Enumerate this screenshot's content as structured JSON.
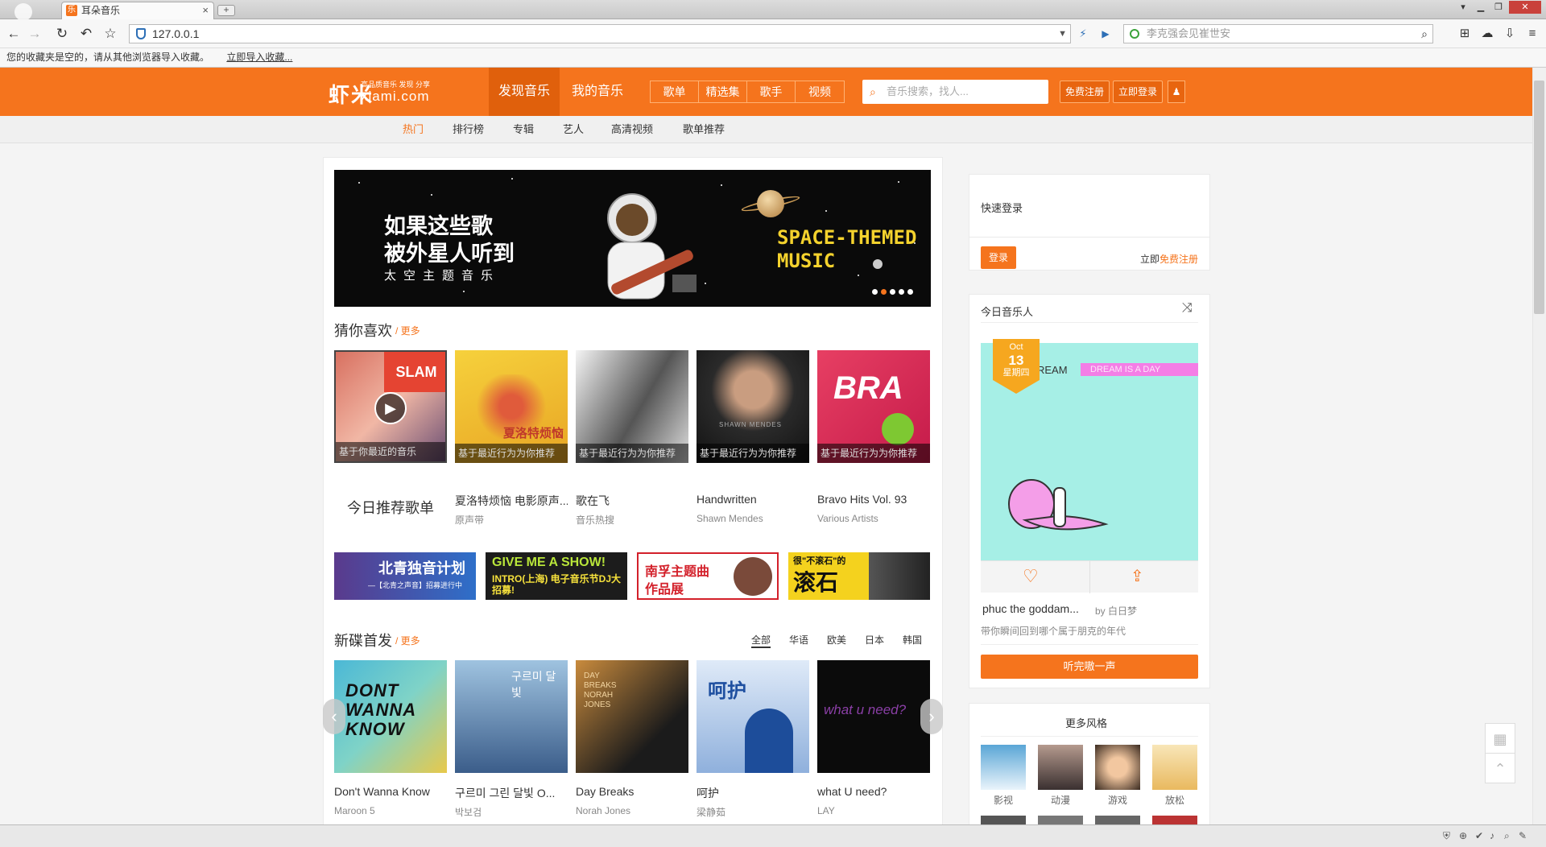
{
  "browser": {
    "tab_title": "耳朵音乐",
    "tab_fav": "乐",
    "tab_close": "×",
    "newtab": "+",
    "url": "127.0.0.1",
    "search_placeholder": "李克强会见崔世安",
    "bookmarks_msg": "您的收藏夹是空的，请从其他浏览器导入收藏。",
    "bookmarks_link": "立即导入收藏..."
  },
  "header": {
    "logo": "虾米",
    "logo_sub1": "高品质音乐 发现 分享",
    "logo_domain": "xiami.com",
    "nav": [
      "发现音乐",
      "我的音乐"
    ],
    "subbtns": [
      "歌单",
      "精选集",
      "歌手",
      "视频"
    ],
    "search_placeholder": "音乐搜索，找人...",
    "register": "免费注册",
    "login": "立即登录"
  },
  "subnav": [
    "热门",
    "排行榜",
    "专辑",
    "艺人",
    "高清视频",
    "歌单推荐"
  ],
  "banner": {
    "line1": "如果这些歌",
    "line2": "被外星人听到",
    "line3": "太空主题音乐",
    "en1": "SPACE-THEMED",
    "en2": "MUSIC"
  },
  "guess": {
    "title": "猜你喜欢",
    "more": "更多",
    "today_label": "今日推荐歌单",
    "items": [
      {
        "cap": "基于你最近的音乐",
        "name": "",
        "artist": ""
      },
      {
        "cap": "基于最近行为为你推荐",
        "name": "夏洛特烦恼 电影原声...",
        "artist": "原声带"
      },
      {
        "cap": "基于最近行为为你推荐",
        "name": "歌在飞",
        "artist": "音乐热搜"
      },
      {
        "cap": "基于最近行为为你推荐",
        "name": "Handwritten",
        "artist": "Shawn Mendes"
      },
      {
        "cap": "基于最近行为为你推荐",
        "name": "Bravo Hits Vol. 93",
        "artist": "Various Artists"
      }
    ]
  },
  "ads": [
    {
      "text": "北青独音计划",
      "sub": "—【北青之声音】招募进行中"
    },
    {
      "text": "GIVE ME A SHOW!",
      "sub": "INTRO(上海) 电子音乐节DJ大招募!"
    },
    {
      "text": "南孚主题曲",
      "sub": "作品展"
    },
    {
      "text": "很\"不滚石\"的",
      "sub": "滚石"
    }
  ],
  "newrel": {
    "title": "新碟首发",
    "more": "更多",
    "filters": [
      "全部",
      "华语",
      "欧美",
      "日本",
      "韩国"
    ],
    "items": [
      {
        "name": "Don't Wanna Know",
        "artist": "Maroon 5",
        "cover_text": "DONT WANNA KNOW"
      },
      {
        "name": "구르미 그린 달빛 O...",
        "artist": "박보검",
        "cover_text": "구르미 달빛"
      },
      {
        "name": "Day Breaks",
        "artist": "Norah Jones",
        "cover_text": "DAY BREAKS NORAH JONES"
      },
      {
        "name": "呵护",
        "artist": "梁静茹",
        "cover_text": "呵护"
      },
      {
        "name": "what U need?",
        "artist": "LAY",
        "cover_text": "what u need?"
      }
    ]
  },
  "sidebar": {
    "quick_login": "快速登录",
    "login_btn": "登录",
    "reg_prefix": "立即",
    "reg_link": "免费注册",
    "today_title": "今日音乐人",
    "badge_month": "Oct",
    "badge_day": "13",
    "badge_week": "星期四",
    "img_dream": "REAM",
    "img_bar": "DREAM IS A DAY",
    "song": "phuc the goddam...",
    "by": "by 白日梦",
    "desc": "带你瞬间回到哪个属于朋克的年代",
    "listen": "听完嗷一声",
    "more_styles": "更多风格",
    "styles": [
      "影视",
      "动漫",
      "游戏",
      "放松"
    ]
  },
  "colors": {
    "brand": "#f5741d",
    "brand_dark": "#e0600c"
  }
}
